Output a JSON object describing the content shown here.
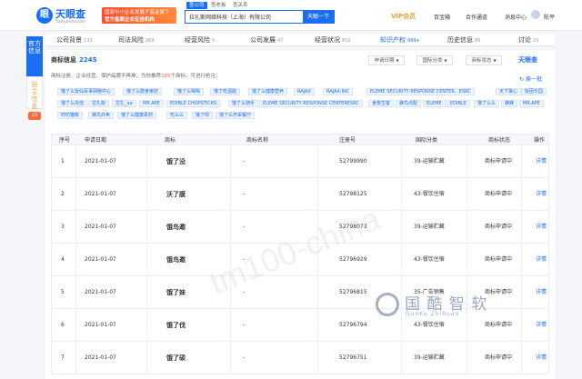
{
  "header": {
    "logo_text": "天眼查",
    "logo_url": "Tianyancha.com",
    "promo_line1": "国家中小企业发展子基金旗下",
    "promo_line2": "官方备案企业征信机构",
    "search_tabs": [
      "查公司",
      "查老板",
      "查关系"
    ],
    "search_value": "拉扎斯网络科技（上海）有限公司",
    "search_button": "天眼一下",
    "vip": "VIP会员",
    "links": [
      "百宝箱",
      "合作通道",
      "消息中心",
      "陈平"
    ]
  },
  "side": {
    "official": "官方信息",
    "self": "自主信息",
    "self_badge": "23"
  },
  "nav": [
    {
      "label": "公司背景",
      "count": "133"
    },
    {
      "label": "司法风险",
      "count": "364"
    },
    {
      "label": "经营风险",
      "count": "5"
    },
    {
      "label": "公司发展",
      "count": "47"
    },
    {
      "label": "经营状况",
      "count": "652"
    },
    {
      "label": "知识产权",
      "count": "999+"
    },
    {
      "label": "历史信息",
      "count": "89"
    },
    {
      "label": "讨论",
      "count": "23"
    }
  ],
  "panel": {
    "title": "商标信息",
    "count": "2245",
    "filters": [
      "申请日期",
      "国际分类",
      "商标状态"
    ],
    "brand": "天眼查",
    "desc_before": "商标注册、企业经营、保护品牌不再难，为你推荐",
    "desc_number": "185",
    "desc_after": "个商标，可进行抢注：",
    "swap": "换一批",
    "tags": [
      "饿了么饭仙百事网络中心",
      "饿了么膳食家纺",
      "饿了么喝喝",
      "饿了吃酒能",
      "饿了么健康营养",
      "RAJAX",
      "RAJAX-INC",
      "ELEME SECURITY RESPONSE CENTER、ESRC",
      "天下掌心",
      "饭团乐园",
      "饿了么充值",
      "拉扎斯",
      "拉扎_aa",
      "MR.APE",
      "EDIBLE CHOPSTICKS",
      "饿了么骑手",
      "ELEME SECURITY RESPONSE CENTERESRC",
      "食荒生客",
      "蜂鸟点配",
      "ELEME",
      "EDIBLE",
      "饿了么么",
      "蜂蜂",
      "MR.APE",
      "叨叨猫帐",
      "蜂鸟外卖",
      "饿了么健康素材",
      "吃么么",
      "饿了呗",
      "饿了么开采餐厅"
    ]
  },
  "table": {
    "headers": [
      "序号",
      "申请日期",
      "商标",
      "商标名称",
      "注册号",
      "国际分类",
      "商标状态",
      "操作"
    ],
    "rows": [
      {
        "no": "1",
        "date": "2021-01-07",
        "mark": "饿了没",
        "name": "-",
        "reg": "52799990",
        "cls": "39-运输贮藏",
        "status": "商标申请中",
        "op": "详情"
      },
      {
        "no": "2",
        "date": "2021-01-07",
        "mark": "沃了膜",
        "name": "-",
        "reg": "52798125",
        "cls": "43-餐饮住宿",
        "status": "商标申请中",
        "op": "详情"
      },
      {
        "no": "3",
        "date": "2021-01-07",
        "mark": "饿鸟邀",
        "name": "-",
        "reg": "52798073",
        "cls": "39-运输贮藏",
        "status": "商标申请中",
        "op": "详情"
      },
      {
        "no": "4",
        "date": "2021-01-07",
        "mark": "饿鸟邀",
        "name": "-",
        "reg": "52796929",
        "cls": "43-餐饮住宿",
        "status": "商标申请中",
        "op": "详情"
      },
      {
        "no": "5",
        "date": "2021-01-07",
        "mark": "饿了妹",
        "name": "-",
        "reg": "52796815",
        "cls": "35-广告销售",
        "status": "商标申请中",
        "op": "详情"
      },
      {
        "no": "6",
        "date": "2021-01-07",
        "mark": "饿了伐",
        "name": "-",
        "reg": "52796794",
        "cls": "43-餐饮住宿",
        "status": "商标申请中",
        "op": "详情"
      },
      {
        "no": "7",
        "date": "2021-01-07",
        "mark": "饿了硕",
        "name": "-",
        "reg": "52796751",
        "cls": "39-运输贮藏",
        "status": "商标申请中",
        "op": "详情"
      }
    ]
  },
  "watermark": {
    "text": "tm100-china",
    "brand_cn": "国 酷 智 软",
    "brand_en": "GuoKu ZhiRuan"
  },
  "colors": {
    "accent": "#1a6ef5",
    "orange": "#ff6a3c",
    "gold": "#e8a23a"
  },
  "icons": [
    "logo-icon",
    "search-icon",
    "chevron-down-icon",
    "refresh-icon",
    "avatar"
  ]
}
